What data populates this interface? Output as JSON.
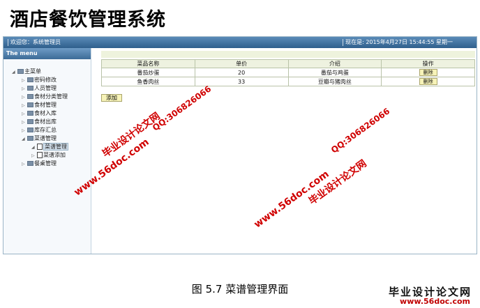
{
  "doc_title": "酒店餐饮管理系统",
  "topbar": {
    "welcome": "欢迎您：系统管理员",
    "now": "现在是: 2015年4月27日 15:44:55 星期一"
  },
  "sidebar": {
    "title": "The menu",
    "root": "主菜单",
    "items": [
      {
        "label": "密码修改"
      },
      {
        "label": "人员管理"
      },
      {
        "label": "食材分类管理"
      },
      {
        "label": "食材管理"
      },
      {
        "label": "食材入库"
      },
      {
        "label": "食材出库"
      },
      {
        "label": "库存汇总"
      },
      {
        "label": "菜谱管理"
      },
      {
        "label": "菜谱管理"
      },
      {
        "label": "菜谱添加"
      },
      {
        "label": "餐桌管理"
      }
    ]
  },
  "table": {
    "headers": [
      "菜品名称",
      "单价",
      "介绍",
      "操作"
    ],
    "rows": [
      {
        "name": "番茄炒蛋",
        "price": "20",
        "desc": "番茄与鸡蛋",
        "action": "删除"
      },
      {
        "name": "鱼香肉丝",
        "price": "33",
        "desc": "豆瓣与猪肉丝",
        "action": "删除"
      }
    ],
    "add_label": "添加"
  },
  "watermarks": {
    "site": "www.56doc.com",
    "qq": "QQ:306826066",
    "brand": "毕业设计论文网"
  },
  "caption": "图 5.7  菜谱管理界面",
  "footer_logo": {
    "brand": "毕业设计论文网",
    "site": "www.56doc.com"
  }
}
